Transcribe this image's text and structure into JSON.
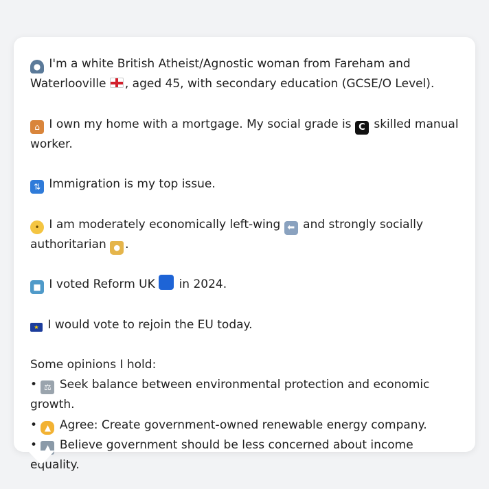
{
  "profile": {
    "line1_text_a": "I'm a white British Atheist/Agnostic woman from Fareham and",
    "line1_text_b": "Waterlooville",
    "line1_text_c": ", aged 45, with secondary education (GCSE/O Level).",
    "line2_text_a": "I own my home with a mortgage. My social grade is",
    "line2_text_b": "skilled manual",
    "line2_text_c": "worker.",
    "line3_text": "Immigration is my top issue.",
    "line4_text_a": "I am moderately economically left-wing",
    "line4_text_b": "and strongly socially",
    "line4_text_c": "authoritarian",
    "line4_text_d": ".",
    "line5_text_a": "I voted Reform UK",
    "line5_text_b": "in 2024.",
    "line6_text": "I would vote to rejoin the EU today.",
    "opinions_heading": "Some opinions I hold:",
    "opinions": [
      "Seek balance between environmental protection and economic growth.",
      "Agree: Create government-owned renewable energy company.",
      "Believe government should be less concerned about income equality."
    ],
    "bullet": "•"
  },
  "icons": {
    "person": "person-icon",
    "england_flag": "england-flag-icon",
    "house": "house-icon",
    "grade_c": "letter-c-icon",
    "arrows": "arrows-icon",
    "thinking": "thinking-face-icon",
    "left_arrow": "left-arrow-icon",
    "lock": "lock-icon",
    "ballot": "ballot-box-icon",
    "blue_square": "blue-square-icon",
    "eu_flag": "eu-flag-icon",
    "scale": "balance-scale-icon",
    "thumbs_up": "thumbs-up-icon",
    "cheese": "cheese-icon"
  },
  "colors": {
    "background": "#f2f3f5",
    "card": "#ffffff",
    "text": "#1f1f1f",
    "reform_blue": "#1e64d6"
  }
}
